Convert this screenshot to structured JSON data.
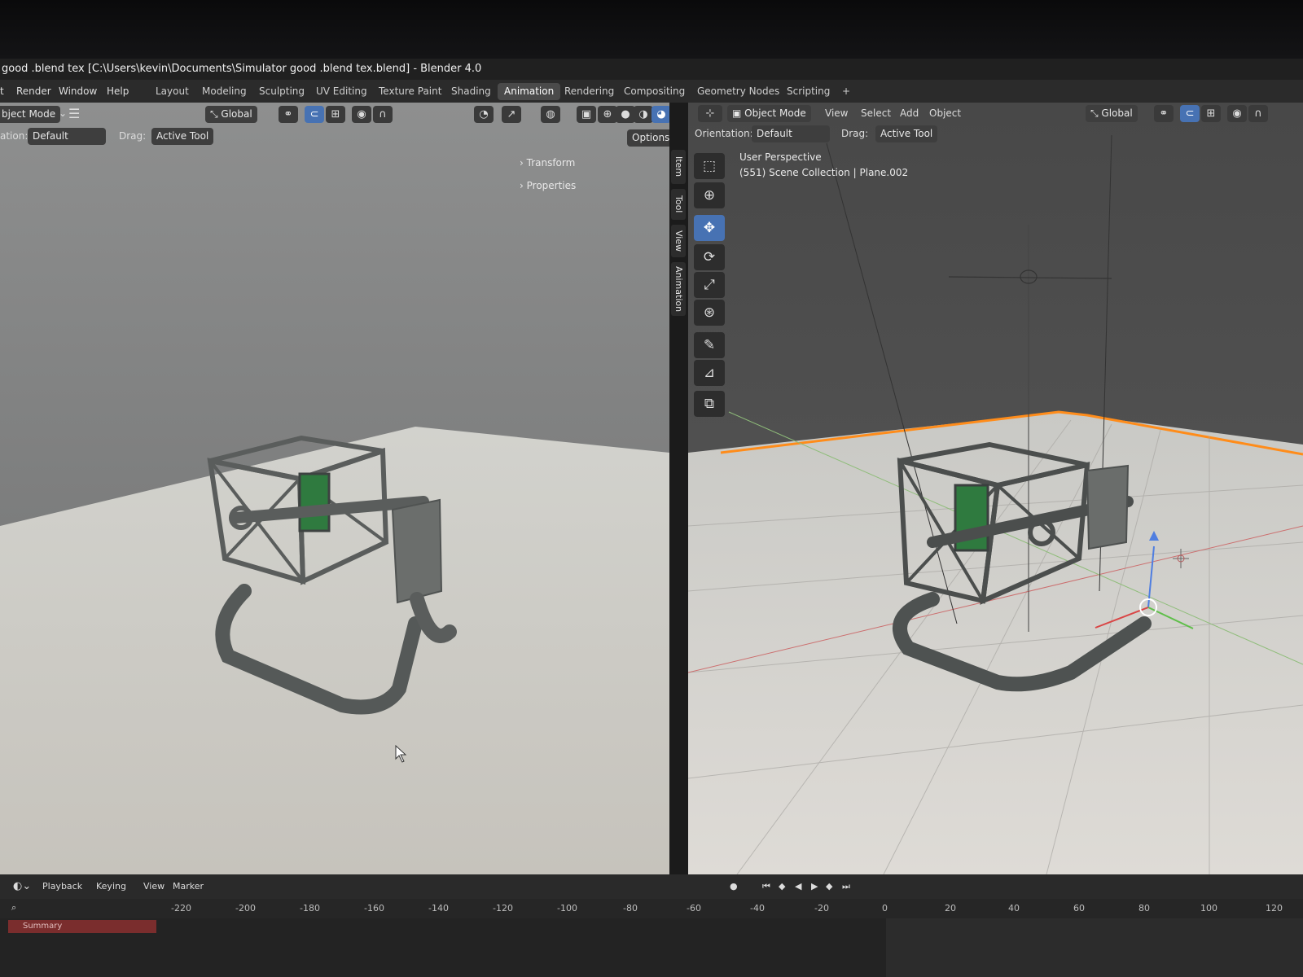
{
  "window": {
    "title": "good .blend tex [C:\\Users\\kevin\\Documents\\Simulator good .blend tex.blend] - Blender 4.0"
  },
  "menubar": {
    "menus": [
      "t",
      "Render",
      "Window",
      "Help"
    ],
    "workspaces": [
      "Layout",
      "Modeling",
      "Sculpting",
      "UV Editing",
      "Texture Paint",
      "Shading",
      "Animation",
      "Rendering",
      "Compositing",
      "Geometry Nodes",
      "Scripting"
    ],
    "active_workspace": "Animation",
    "add_tab_label": "+"
  },
  "left_viewport": {
    "mode_label": "bject Mode",
    "transform_space": "Global",
    "options_label": "Options",
    "orientation_label": "ation:",
    "orientation_value": "Default",
    "drag_label": "Drag:",
    "drag_value": "Active Tool",
    "npanel": [
      "Transform",
      "Properties"
    ],
    "side_tabs": [
      "Item",
      "Tool",
      "View",
      "Animation"
    ]
  },
  "right_viewport": {
    "mode_label": "Object Mode",
    "menus": [
      "View",
      "Select",
      "Add",
      "Object"
    ],
    "transform_space": "Global",
    "orientation_label": "Orientation:",
    "orientation_value": "Default",
    "drag_label": "Drag:",
    "drag_value": "Active Tool",
    "view_name": "User Perspective",
    "collection_info": "(551) Scene Collection | Plane.002"
  },
  "timeline": {
    "menus": [
      "Playback",
      "Keying",
      "View",
      "Marker"
    ],
    "channel": "Summary",
    "ruler": [
      "-220",
      "-200",
      "-180",
      "-160",
      "-140",
      "-120",
      "-100",
      "-80",
      "-60",
      "-40",
      "-20",
      "0",
      "20",
      "40",
      "60",
      "80",
      "100",
      "120"
    ]
  },
  "colors": {
    "accent_blue": "#4772b3",
    "selection_orange": "#ff8c1a",
    "summary_red": "#7a2d2d"
  },
  "icons": [
    "select-box-icon",
    "cursor-icon",
    "move-icon",
    "rotate-icon",
    "scale-icon",
    "transform-icon",
    "annotate-icon",
    "measure-icon",
    "add-cube-icon"
  ]
}
